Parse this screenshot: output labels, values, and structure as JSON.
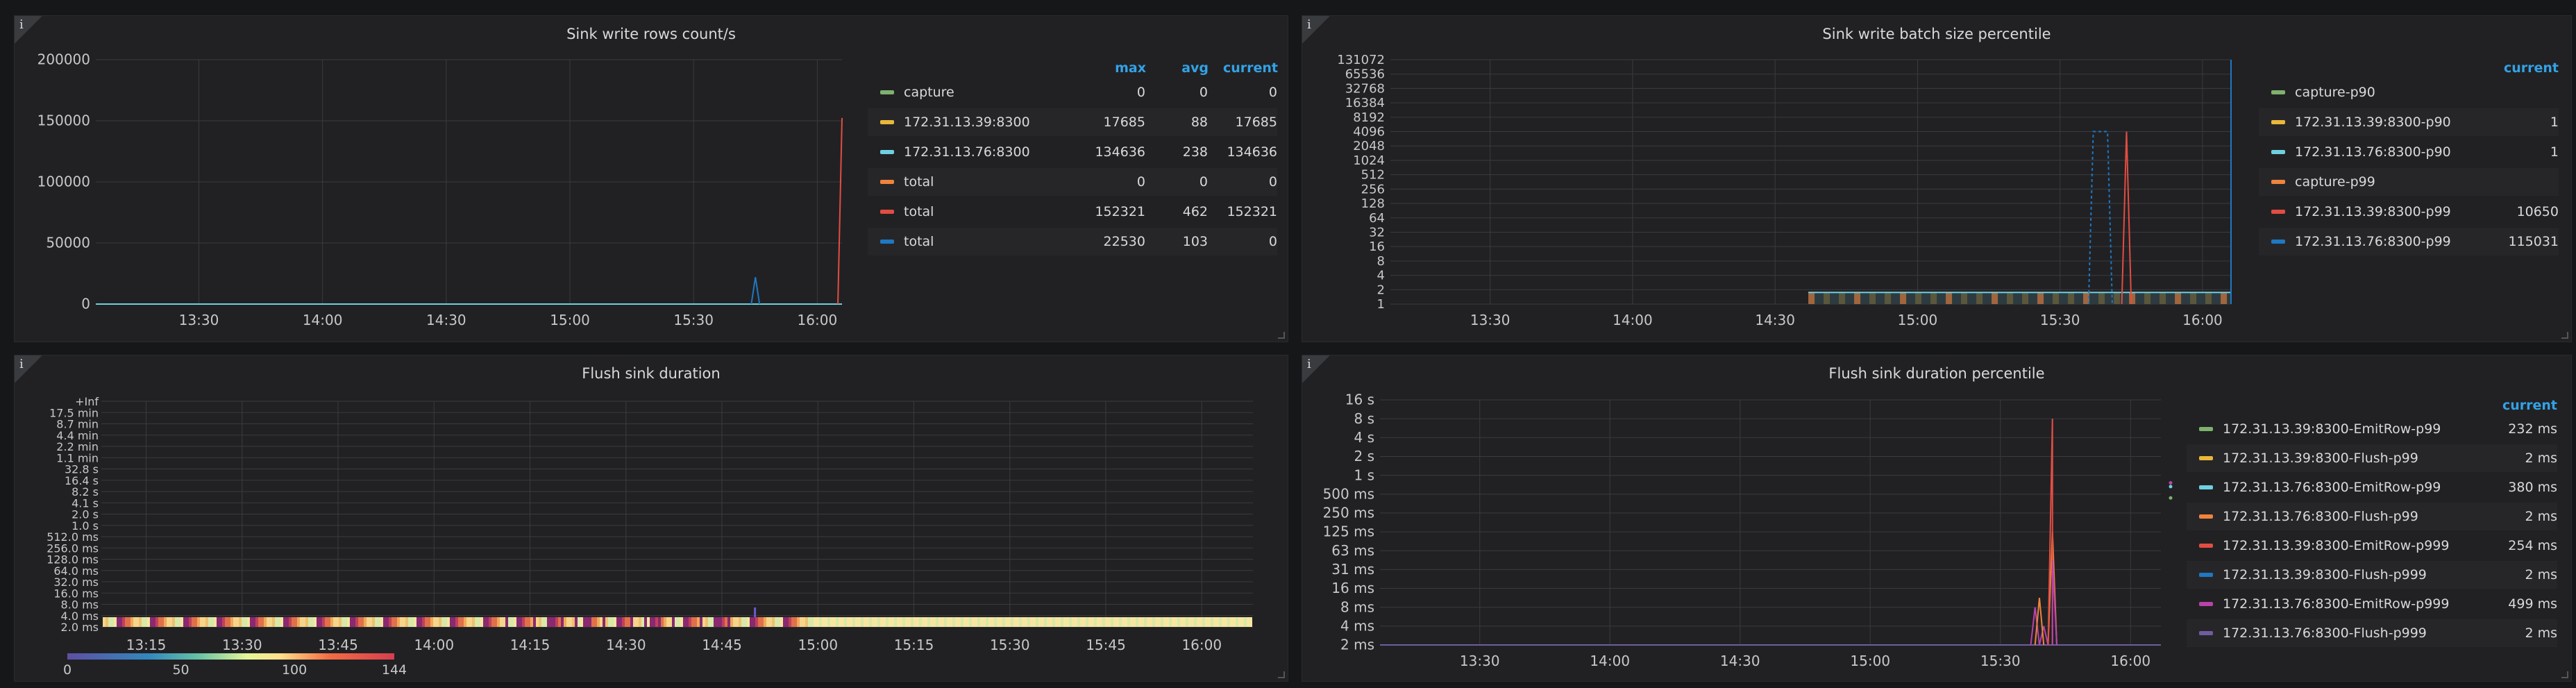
{
  "panels": {
    "rows": {
      "title": "Sink write rows count/s",
      "info": "i",
      "legend_headers": {
        "max": "max",
        "avg": "avg",
        "current": "current"
      },
      "legend": [
        {
          "name": "capture",
          "color": "#7eb26d",
          "max": "0",
          "avg": "0",
          "current": "0"
        },
        {
          "name": "172.31.13.39:8300",
          "color": "#eab839",
          "max": "17685",
          "avg": "88",
          "current": "17685"
        },
        {
          "name": "172.31.13.76:8300",
          "color": "#6ed0e0",
          "max": "134636",
          "avg": "238",
          "current": "134636"
        },
        {
          "name": "total",
          "color": "#ef843c",
          "max": "0",
          "avg": "0",
          "current": "0"
        },
        {
          "name": "total",
          "color": "#e24d42",
          "max": "152321",
          "avg": "462",
          "current": "152321"
        },
        {
          "name": "total",
          "color": "#1f78c1",
          "max": "22530",
          "avg": "103",
          "current": "0"
        }
      ]
    },
    "batch": {
      "title": "Sink write batch size percentile",
      "info": "i",
      "legend_headers": {
        "current": "current"
      },
      "legend": [
        {
          "name": "capture-p90",
          "color": "#7eb26d",
          "current": ""
        },
        {
          "name": "172.31.13.39:8300-p90",
          "color": "#eab839",
          "current": "1"
        },
        {
          "name": "172.31.13.76:8300-p90",
          "color": "#6ed0e0",
          "current": "1"
        },
        {
          "name": "capture-p99",
          "color": "#ef843c",
          "current": ""
        },
        {
          "name": "172.31.13.39:8300-p99",
          "color": "#e24d42",
          "current": "10650"
        },
        {
          "name": "172.31.13.76:8300-p99",
          "color": "#1f78c1",
          "current": "115031"
        }
      ]
    },
    "flush": {
      "title": "Flush sink duration",
      "info": "i",
      "colorbar_ticks": [
        "0",
        "50",
        "100",
        "144"
      ]
    },
    "flushp": {
      "title": "Flush sink duration percentile",
      "info": "i",
      "legend_headers": {
        "current": "current"
      },
      "legend": [
        {
          "name": "172.31.13.39:8300-EmitRow-p99",
          "color": "#7eb26d",
          "current": "232 ms"
        },
        {
          "name": "172.31.13.39:8300-Flush-p99",
          "color": "#eab839",
          "current": "2 ms"
        },
        {
          "name": "172.31.13.76:8300-EmitRow-p99",
          "color": "#6ed0e0",
          "current": "380 ms"
        },
        {
          "name": "172.31.13.76:8300-Flush-p99",
          "color": "#ef843c",
          "current": "2 ms"
        },
        {
          "name": "172.31.13.39:8300-EmitRow-p999",
          "color": "#e24d42",
          "current": "254 ms"
        },
        {
          "name": "172.31.13.39:8300-Flush-p999",
          "color": "#1f78c1",
          "current": "2 ms"
        },
        {
          "name": "172.31.13.76:8300-EmitRow-p999",
          "color": "#ba43a9",
          "current": "499 ms"
        },
        {
          "name": "172.31.13.76:8300-Flush-p999",
          "color": "#705da0",
          "current": "2 ms"
        }
      ]
    }
  },
  "chart_data": [
    {
      "type": "line",
      "title": "Sink write rows count/s",
      "y_ticks": [
        "200000",
        "150000",
        "100000",
        "50000",
        "0"
      ],
      "x_ticks": [
        "13:30",
        "14:00",
        "14:30",
        "15:00",
        "15:30",
        "16:00"
      ],
      "ylim": [
        0,
        200000
      ],
      "series": [
        {
          "name": "172.31.13.76:8300",
          "points": [
            [
              "15:44",
              0
            ],
            [
              "15:45",
              22000
            ],
            [
              "15:46",
              0
            ]
          ]
        },
        {
          "name": "total",
          "points": [
            [
              "16:05",
              0
            ],
            [
              "16:06",
              152321
            ]
          ]
        }
      ]
    },
    {
      "type": "line",
      "title": "Sink write batch size percentile",
      "y_ticks": [
        "131072",
        "65536",
        "32768",
        "16384",
        "8192",
        "4096",
        "2048",
        "1024",
        "512",
        "256",
        "128",
        "64",
        "32",
        "16",
        "8",
        "4",
        "2",
        "1"
      ],
      "x_ticks": [
        "13:30",
        "14:00",
        "14:30",
        "15:00",
        "15:30",
        "16:00"
      ],
      "scale": "log2",
      "series": [
        {
          "name": "172.31.13.76:8300-p99",
          "points": [
            [
              "15:36",
              1
            ],
            [
              "15:37",
              4096
            ],
            [
              "15:40",
              4096
            ],
            [
              "15:41",
              1
            ]
          ]
        },
        {
          "name": "172.31.13.39:8300-p99",
          "points": [
            [
              "15:43",
              1
            ],
            [
              "15:44",
              4096
            ],
            [
              "15:45",
              1
            ]
          ]
        }
      ]
    },
    {
      "type": "heatmap",
      "title": "Flush sink duration",
      "y_ticks": [
        "+Inf",
        "17.5 min",
        "8.7 min",
        "4.4 min",
        "2.2 min",
        "1.1 min",
        "32.8 s",
        "16.4 s",
        "8.2 s",
        "4.1 s",
        "2.0 s",
        "1.0 s",
        "512.0 ms",
        "256.0 ms",
        "128.0 ms",
        "64.0 ms",
        "32.0 ms",
        "16.0 ms",
        "8.0 ms",
        "4.0 ms",
        "2.0 ms"
      ],
      "x_ticks": [
        "13:15",
        "13:30",
        "13:45",
        "14:00",
        "14:15",
        "14:30",
        "14:45",
        "15:00",
        "15:15",
        "15:30",
        "15:45",
        "16:00"
      ],
      "color_range": [
        0,
        144
      ]
    },
    {
      "type": "line",
      "title": "Flush sink duration percentile",
      "y_ticks": [
        "16 s",
        "8 s",
        "4 s",
        "2 s",
        "1 s",
        "500 ms",
        "250 ms",
        "125 ms",
        "63 ms",
        "31 ms",
        "16 ms",
        "8 ms",
        "4 ms",
        "2 ms"
      ],
      "x_ticks": [
        "13:30",
        "14:00",
        "14:30",
        "15:00",
        "15:30",
        "16:00"
      ],
      "scale": "log2"
    }
  ]
}
